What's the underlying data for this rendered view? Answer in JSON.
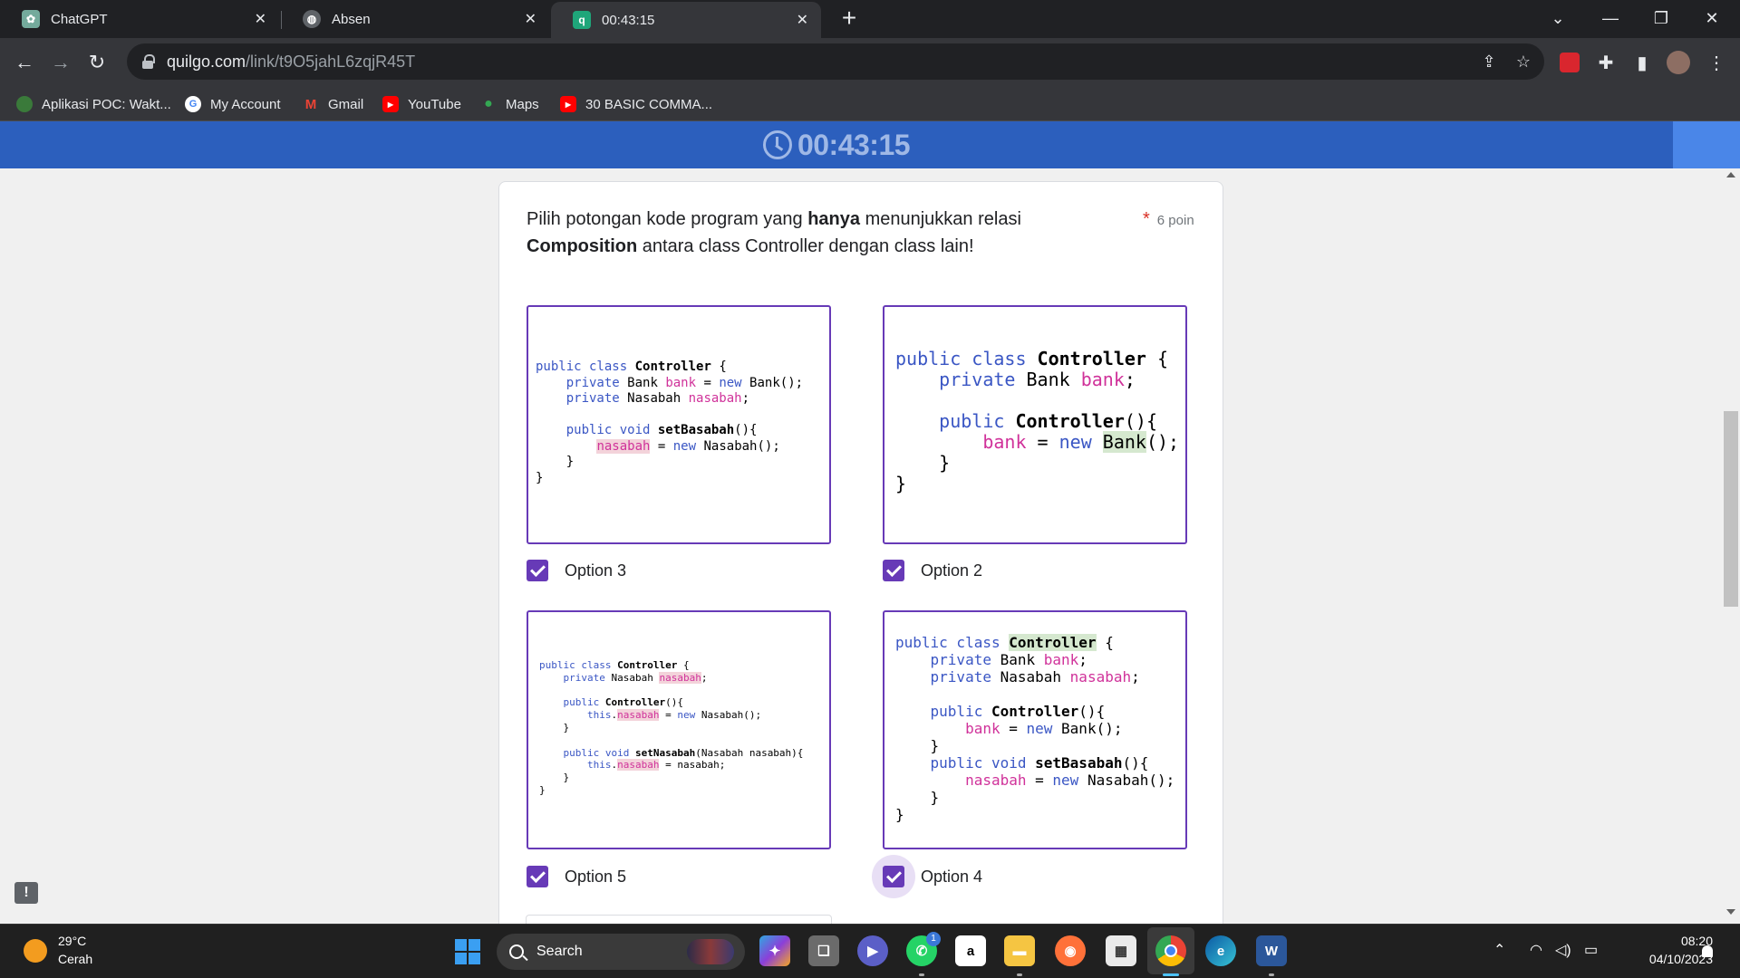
{
  "browser": {
    "tabs": [
      {
        "title": "ChatGPT",
        "icon": "chatgpt-icon"
      },
      {
        "title": "Absen",
        "icon": "globe-icon"
      },
      {
        "title": "00:43:15",
        "icon": "quilgo-icon",
        "active": true
      }
    ],
    "url": {
      "host": "quilgo.com",
      "path": "/link/t9O5jahL6zqjR45T"
    },
    "bookmarks": [
      "Aplikasi POC: Wakt...",
      "My Account",
      "Gmail",
      "YouTube",
      "Maps",
      "30 BASIC COMMA..."
    ],
    "accent": "#35363a"
  },
  "page": {
    "timer": "00:43:15",
    "question": {
      "part1": "Pilih potongan kode program yang ",
      "bold1": "hanya",
      "part2": " menunjukkan relasi ",
      "bold2": "Composition",
      "part3": " antara class Controller dengan class lain!",
      "points": "6 poin",
      "required_mark": "*"
    },
    "options": [
      {
        "label": "Option 3",
        "checked": true
      },
      {
        "label": "Option 2",
        "checked": true
      },
      {
        "label": "Option 5",
        "checked": true
      },
      {
        "label": "Option 4",
        "checked": true
      }
    ],
    "accent": "#673ab7",
    "feedback_icon": "!"
  },
  "taskbar": {
    "weather_temp": "29°C",
    "weather_desc": "Cerah",
    "search_label": "Search",
    "time": "08:20",
    "date": "04/10/2023",
    "whatsapp_badge": "1"
  }
}
